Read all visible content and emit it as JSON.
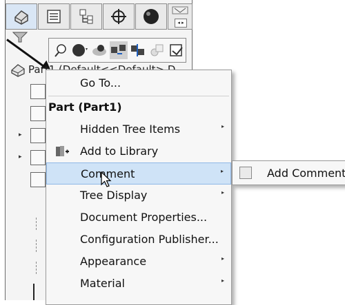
{
  "tree": {
    "root_label": "Part1 (Default<<Default> D"
  },
  "context_menu": {
    "items": [
      {
        "type": "item",
        "label": "Go To...",
        "mnemonic_underline": "G",
        "submenu": false
      },
      {
        "type": "header",
        "label": "Part (Part1)"
      },
      {
        "type": "item",
        "label": "Hidden Tree Items",
        "submenu": true
      },
      {
        "type": "item",
        "label": "Add to Library",
        "mnemonic_underline": "A",
        "submenu": false,
        "icon": "add-to-library-icon"
      },
      {
        "type": "item",
        "label": "Comment",
        "submenu": true,
        "highlighted": true
      },
      {
        "type": "item",
        "label": "Tree Display",
        "submenu": true
      },
      {
        "type": "item",
        "label": "Document Properties...",
        "mnemonic_underline": "D",
        "submenu": false
      },
      {
        "type": "item",
        "label": "Configuration Publisher...",
        "submenu": false
      },
      {
        "type": "item",
        "label": "Appearance",
        "submenu": true
      },
      {
        "type": "item",
        "label": "Material",
        "submenu": true
      }
    ]
  },
  "comment_submenu": {
    "label": "Add Comment",
    "icon": "add-comment-icon"
  },
  "icons": {
    "tabs": [
      "feature-manager-icon",
      "property-manager-icon",
      "configuration-manager-icon",
      "dimxpert-icon",
      "display-manager-icon"
    ],
    "submenu_arrow": "▸",
    "accent_highlight": "#cfe3f7"
  }
}
